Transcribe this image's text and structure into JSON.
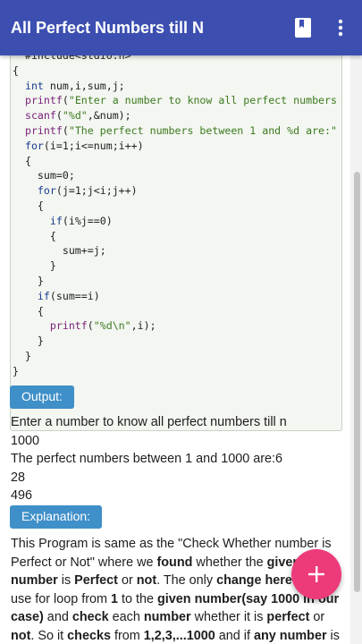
{
  "appbar": {
    "title": "All Perfect Numbers till N",
    "icons": [
      "moon-icon",
      "bookmark-icon",
      "more-vert-icon"
    ]
  },
  "code": {
    "lines": [
      "  #include<stdio.h>",
      "{",
      "  int num,i,sum,j;",
      "  printf(\"Enter a number to know all perfect numbers",
      "  scanf(\"%d\",&num);",
      "  printf(\"The perfect numbers between 1 and %d are:\"",
      "  for(i=1;i<=num;i++)",
      "  {",
      "    sum=0;",
      "    for(j=1;j<i;j++)",
      "    {",
      "      if(i%j==0)",
      "      {",
      "        sum+=j;",
      "      }",
      "    }",
      "    if(sum==i)",
      "    {",
      "      printf(\"%d\\n\",i);",
      "    }",
      "  }",
      "}"
    ]
  },
  "output": {
    "label": "Output:",
    "lines": [
      "Enter a number to know all perfect numbers till n",
      "1000",
      "The perfect numbers between 1 and 1000 are:6",
      "28",
      "496"
    ]
  },
  "explanation": {
    "label": "Explanation:",
    "p1": "This Program is same as the \"Check Whether number is Perfect or Not\" where we ",
    "p1b": "found",
    "p2": " whether the ",
    "p2b": "given number",
    "p3": " is ",
    "p3b": "Perfect",
    "p4": " or ",
    "p4b": "not",
    "p5": ". The only ",
    "p5b": "change here",
    "p6": " is we use for loop from ",
    "p6b": "1",
    "p7": " to the ",
    "p7b": "given number(say 1000 in our case)",
    "p8": " and ",
    "p8b": "check",
    "p9": " each ",
    "p9b": "number",
    "p10": " whether it is ",
    "p10b": "perfect",
    "p11": " or ",
    "p11b": "not",
    "p12": ". So it ",
    "p12b": "checks",
    "p13": " from ",
    "p13b": "1,2,3,...1000",
    "p14": " and if ",
    "p14b": "any number",
    "p15": " is having the"
  },
  "fab": {
    "symbol": "+"
  },
  "colors": {
    "appbar": "#3c4fb1",
    "tag": "#3f8fc8",
    "fab": "#ec3a7a"
  }
}
